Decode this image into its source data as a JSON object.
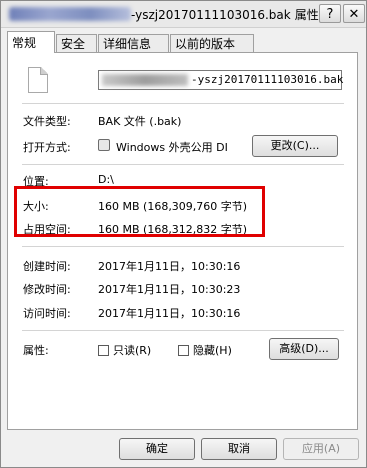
{
  "window": {
    "title_file": "-yszj20170111103016.bak",
    "title_suffix": "属性",
    "help_label": "?",
    "close_label": "✕"
  },
  "tabs": [
    "常规",
    "安全",
    "详细信息",
    "以前的版本"
  ],
  "active_tab": "常规",
  "file": {
    "icon": "file-icon",
    "name_visible": "-yszj20170111103016.bak"
  },
  "props": {
    "type_label": "文件类型:",
    "type_value": "BAK 文件 (.bak)",
    "open_label": "打开方式:",
    "open_value": "Windows 外壳公用 DI",
    "change_button": "更改(C)...",
    "location_label": "位置:",
    "location_value": "D:\\",
    "size_label": "大小:",
    "size_value": "160 MB (168,309,760 字节)",
    "disk_label": "占用空间:",
    "disk_value": "160 MB (168,312,832 字节)",
    "created_label": "创建时间:",
    "created_value": "2017年1月11日，10:30:16",
    "modified_label": "修改时间:",
    "modified_value": "2017年1月11日，10:30:23",
    "accessed_label": "访问时间:",
    "accessed_value": "2017年1月11日，10:30:16",
    "attr_label": "属性:",
    "readonly_label": "只读(R)",
    "hidden_label": "隐藏(H)",
    "advanced_button": "高级(D)..."
  },
  "footer": {
    "ok": "确定",
    "cancel": "取消",
    "apply": "应用(A)"
  },
  "colors": {
    "highlight": "#e00000"
  }
}
